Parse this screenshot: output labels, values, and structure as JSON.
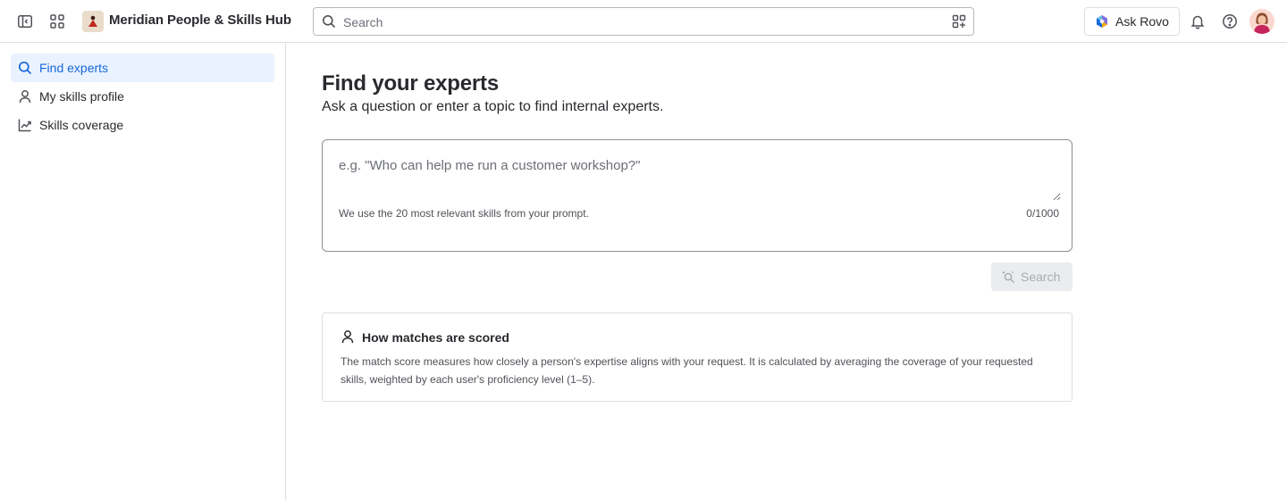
{
  "app": {
    "title": "Meridian People & Skills Hub"
  },
  "topbar": {
    "search_placeholder": "Search",
    "ask_rovo_label": "Ask Rovo",
    "icons": [
      "sidebar-toggle-icon",
      "app-switcher-icon",
      "search-icon",
      "search-filter-icon",
      "rovo-icon",
      "bell-icon",
      "help-icon"
    ]
  },
  "sidebar": {
    "items": [
      {
        "label": "Find experts",
        "icon": "search-icon",
        "active": true
      },
      {
        "label": "My skills profile",
        "icon": "person-icon",
        "active": false
      },
      {
        "label": "Skills coverage",
        "icon": "trend-chart-icon",
        "active": false
      }
    ]
  },
  "main": {
    "title": "Find your experts",
    "subtitle": "Ask a question or enter a topic to find internal experts.",
    "prompt": {
      "value": "",
      "placeholder": "e.g. \"Who can help me run a customer workshop?\"",
      "hint": "We use the 20 most relevant skills from your prompt.",
      "counter": "0/1000"
    },
    "search_button_label": "Search",
    "info": {
      "title": "How matches are scored",
      "body": "The match score measures how closely a person's expertise aligns with your request. It is calculated by averaging the coverage of your requested skills, weighted by each user's proficiency level (1–5)."
    }
  },
  "colors": {
    "accent": "#1868db",
    "active_bg": "#e9f2fe",
    "border": "#dddee1",
    "disabled_bg": "#ebecef",
    "disabled_text": "#a9abb1"
  }
}
